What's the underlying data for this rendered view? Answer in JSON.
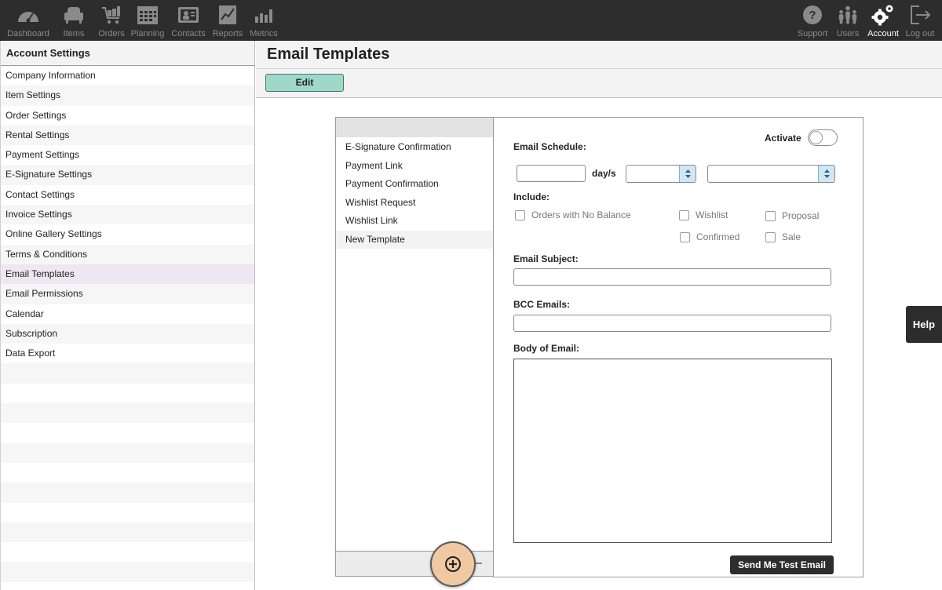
{
  "nav": {
    "left": [
      {
        "label": "Dashboard",
        "icon": "dashboard-gauge-icon"
      },
      {
        "label": "Items",
        "icon": "items-armchair-icon"
      },
      {
        "label": "Orders",
        "icon": "orders-cart-icon"
      },
      {
        "label": "Planning",
        "icon": "planning-calendar-icon"
      },
      {
        "label": "Contacts",
        "icon": "contacts-card-icon"
      },
      {
        "label": "Reports",
        "icon": "reports-chart-icon"
      },
      {
        "label": "Metrics",
        "icon": "metrics-bars-icon"
      }
    ],
    "right": [
      {
        "label": "Support",
        "icon": "support-question-icon"
      },
      {
        "label": "Users",
        "icon": "users-group-icon"
      },
      {
        "label": "Account",
        "icon": "account-gears-icon",
        "active": true
      },
      {
        "label": "Log out",
        "icon": "logout-arrow-icon"
      }
    ]
  },
  "sidebar": {
    "title": "Account Settings",
    "items": [
      "Company Information",
      "Item Settings",
      "Order Settings",
      "Rental Settings",
      "Payment Settings",
      "E-Signature Settings",
      "Contact Settings",
      "Invoice Settings",
      "Online Gallery Settings",
      "Terms & Conditions",
      "Email Templates",
      "Email Permissions",
      "Calendar",
      "Subscription",
      "Data Export"
    ],
    "active_item": "Email Templates"
  },
  "main": {
    "title": "Email Templates",
    "edit_label": "Edit"
  },
  "templates": {
    "items": [
      "E-Signature Confirmation",
      "Payment Link",
      "Payment Confirmation",
      "Wishlist Request",
      "Wishlist Link",
      "New Template"
    ],
    "selected": "New Template"
  },
  "form": {
    "activate_label": "Activate",
    "schedule_label": "Email Schedule:",
    "days_value": "",
    "days_unit": "day/s",
    "schedule_select_1": "",
    "schedule_select_2": "",
    "include_label": "Include:",
    "include_options": {
      "orders_no_balance": "Orders with No Balance",
      "wishlist": "Wishlist",
      "proposal": "Proposal",
      "confirmed": "Confirmed",
      "sale": "Sale"
    },
    "subject_label": "Email Subject:",
    "subject_value": "",
    "bcc_label": "BCC  Emails:",
    "bcc_value": "",
    "body_label": "Body of Email:",
    "body_value": "",
    "test_button": "Send Me Test Email"
  },
  "help_label": "Help",
  "colors": {
    "topbar": "#2d2d2d",
    "edit_button": "#9fd8ca",
    "active_sidebar": "#eee6f1",
    "add_button": "#f0c9a3",
    "spinner": "#cfe6f7"
  }
}
